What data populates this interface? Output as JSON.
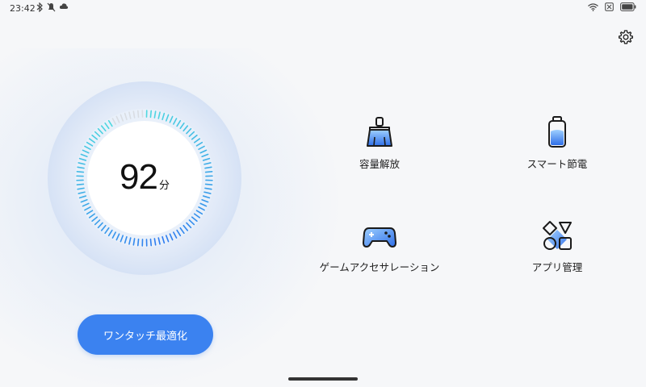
{
  "status_bar": {
    "time": "23:42",
    "left_icons": [
      "bluetooth-icon",
      "mute-icon",
      "cloud-icon"
    ],
    "right_icons": [
      "wifi-icon",
      "sim-off-icon",
      "battery-icon"
    ]
  },
  "header": {
    "settings_icon": "gear-icon"
  },
  "gauge": {
    "value": "92",
    "unit": "分",
    "level_fraction": 0.92,
    "colors": {
      "start": "#2e7bf0",
      "end": "#4fd8e0",
      "remaining": "#d9dde3"
    }
  },
  "optimize_button": {
    "label": "ワンタッチ最適化"
  },
  "features": [
    {
      "label": "容量解放",
      "icon": "broom-icon"
    },
    {
      "label": "スマート節電",
      "icon": "battery-saver-icon"
    },
    {
      "label": "ゲームアクセサレーション",
      "icon": "gamepad-icon"
    },
    {
      "label": "アプリ管理",
      "icon": "app-shapes-icon"
    }
  ],
  "colors": {
    "accent": "#3b82f0",
    "background": "#f6f7f9"
  }
}
